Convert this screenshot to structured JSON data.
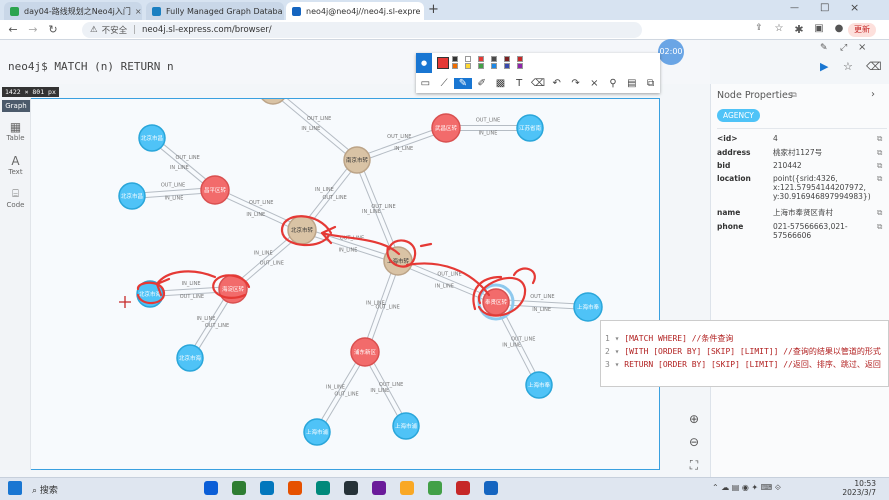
{
  "browser": {
    "tabs": [
      {
        "label": "day04-路线规划之Neo4j入门",
        "color": "#2da44e"
      },
      {
        "label": "Fully Managed Graph Databa",
        "color": "#1a7fc1"
      },
      {
        "label": "neo4j@neo4j//neo4j.sl-expre",
        "color": "#1565c0"
      }
    ],
    "security": "不安全",
    "url": "neo4j.sl-express.com/browser/",
    "update_label": "更新"
  },
  "editor": {
    "prompt": "neo4j$ MATCH (n) RETURN n",
    "timer": "02:00",
    "dimension": "1422 × 801 px"
  },
  "sidebar": {
    "graph": "Graph",
    "table": "Table",
    "text": "Text",
    "code": "Code"
  },
  "graph": {
    "nodes": [
      {
        "id": "top",
        "label": "岳阳市转",
        "color": "#d9c3a5"
      },
      {
        "id": "bj1",
        "label": "北京市昌",
        "color": "#4fc3f7"
      },
      {
        "id": "bj2",
        "label": "北京市昌",
        "color": "#4fc3f7"
      },
      {
        "id": "changping",
        "label": "昌平区转",
        "color": "#f26b6b"
      },
      {
        "id": "nanjing",
        "label": "南京市转",
        "color": "#d9c3a5"
      },
      {
        "id": "wuchang",
        "label": "武昌区转",
        "color": "#f26b6b"
      },
      {
        "id": "jiangsu",
        "label": "江苏省南",
        "color": "#4fc3f7"
      },
      {
        "id": "beijing",
        "label": "北京市转",
        "color": "#d9c3a5"
      },
      {
        "id": "shanghai",
        "label": "上海市转",
        "color": "#d9c3a5"
      },
      {
        "id": "bjhai",
        "label": "北京市海",
        "color": "#4fc3f7"
      },
      {
        "id": "haidian",
        "label": "海淀区转",
        "color": "#f26b6b"
      },
      {
        "id": "bjhai2",
        "label": "北京市海",
        "color": "#4fc3f7"
      },
      {
        "id": "fengxian",
        "label": "奉贤区转",
        "color": "#f26b6b"
      },
      {
        "id": "shfeng",
        "label": "上海市奉",
        "color": "#4fc3f7"
      },
      {
        "id": "shfeng2",
        "label": "上海市奉",
        "color": "#4fc3f7"
      },
      {
        "id": "pudong",
        "label": "浦东新区",
        "color": "#f26b6b"
      },
      {
        "id": "shpu1",
        "label": "上海市浦",
        "color": "#4fc3f7"
      },
      {
        "id": "shpu2",
        "label": "上海市浦",
        "color": "#4fc3f7"
      }
    ],
    "edge_labels": [
      "IN_LINE",
      "OUT_LINE"
    ]
  },
  "properties": {
    "title": "Node Properties",
    "badge": "AGENCY",
    "rows": [
      {
        "key": "<id>",
        "value": "4"
      },
      {
        "key": "address",
        "value": "桃家村1127号"
      },
      {
        "key": "bid",
        "value": "210442"
      },
      {
        "key": "location",
        "value": "point({srid:4326, x:121.57954144207972, y:30.916946897994983})"
      },
      {
        "key": "name",
        "value": "上海市奉贤区青村"
      },
      {
        "key": "phone",
        "value": "021-57566663,021-57566606"
      }
    ]
  },
  "code": {
    "lines": [
      {
        "n": "1",
        "text": "[MATCH WHERE]  //条件查询"
      },
      {
        "n": "2",
        "text": "[WITH [ORDER BY] [SKIP] [LIMIT]] //查询的结果以管道的形式"
      },
      {
        "n": "3",
        "text": "RETURN [ORDER BY] [SKIP] [LIMIT]  //返回、排序、跳过、返回"
      }
    ]
  },
  "taskbar": {
    "search": "搜索",
    "time": "10:53",
    "date": "2023/3/7"
  },
  "annotation_colors": [
    "#333333",
    "#ffffff",
    "#e53935",
    "#4a4a4a",
    "#7b1f1f",
    "#c62828",
    "#ef6c00",
    "#fdd835",
    "#43a047",
    "#1e88e5",
    "#3949ab",
    "#8e24aa"
  ]
}
